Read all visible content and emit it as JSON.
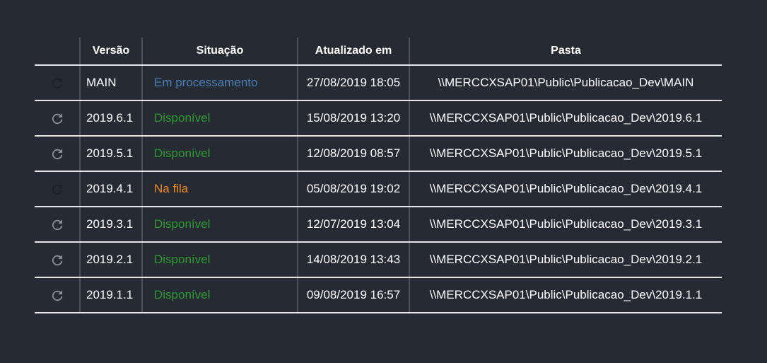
{
  "table": {
    "headers": {
      "icon": "",
      "version": "Versão",
      "status": "Situação",
      "updated": "Atualizado em",
      "folder": "Pasta"
    },
    "rows": [
      {
        "refresh_icon": "refresh-icon",
        "refresh_enabled": false,
        "version": "MAIN",
        "status": "Em processamento",
        "status_kind": "processing",
        "updated": "27/08/2019 18:05",
        "folder": "\\\\MERCCXSAP01\\Public\\Publicacao_Dev\\MAIN"
      },
      {
        "refresh_icon": "refresh-icon",
        "refresh_enabled": true,
        "version": "2019.6.1",
        "status": "Disponível",
        "status_kind": "available",
        "updated": "15/08/2019 13:20",
        "folder": "\\\\MERCCXSAP01\\Public\\Publicacao_Dev\\2019.6.1"
      },
      {
        "refresh_icon": "refresh-icon",
        "refresh_enabled": true,
        "version": "2019.5.1",
        "status": "Disponível",
        "status_kind": "available",
        "updated": "12/08/2019 08:57",
        "folder": "\\\\MERCCXSAP01\\Public\\Publicacao_Dev\\2019.5.1"
      },
      {
        "refresh_icon": "refresh-icon",
        "refresh_enabled": false,
        "version": "2019.4.1",
        "status": "Na fila",
        "status_kind": "queue",
        "updated": "05/08/2019 19:02",
        "folder": "\\\\MERCCXSAP01\\Public\\Publicacao_Dev\\2019.4.1"
      },
      {
        "refresh_icon": "refresh-icon",
        "refresh_enabled": true,
        "version": "2019.3.1",
        "status": "Disponível",
        "status_kind": "available",
        "updated": "12/07/2019 13:04",
        "folder": "\\\\MERCCXSAP01\\Public\\Publicacao_Dev\\2019.3.1"
      },
      {
        "refresh_icon": "refresh-icon",
        "refresh_enabled": true,
        "version": "2019.2.1",
        "status": "Disponível",
        "status_kind": "available",
        "updated": "14/08/2019 13:43",
        "folder": "\\\\MERCCXSAP01\\Public\\Publicacao_Dev\\2019.2.1"
      },
      {
        "refresh_icon": "refresh-icon",
        "refresh_enabled": true,
        "version": "2019.1.1",
        "status": "Disponível",
        "status_kind": "available",
        "updated": "09/08/2019 16:57",
        "folder": "\\\\MERCCXSAP01\\Public\\Publicacao_Dev\\2019.1.1"
      }
    ]
  },
  "colors": {
    "background": "#262a33",
    "processing": "#4a7fb5",
    "available": "#2f9a33",
    "queue": "#f08a24",
    "icon_enabled": "#8a9097",
    "icon_disabled": "#1c1f25"
  }
}
